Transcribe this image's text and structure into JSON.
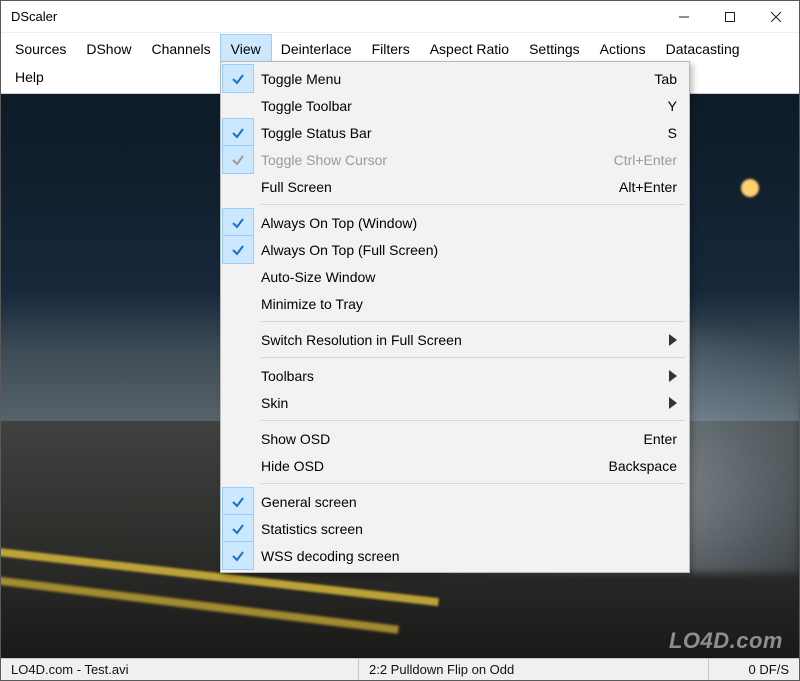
{
  "window": {
    "title": "DScaler"
  },
  "menu": {
    "items": [
      "Sources",
      "DShow",
      "Channels",
      "View",
      "Deinterlace",
      "Filters",
      "Aspect Ratio",
      "Settings",
      "Actions",
      "Datacasting",
      "Help"
    ],
    "active_index": 3
  },
  "view_menu": {
    "items": [
      {
        "label": "Toggle Menu",
        "shortcut": "Tab",
        "checked": true,
        "disabled": false,
        "submenu": false
      },
      {
        "label": "Toggle Toolbar",
        "shortcut": "Y",
        "checked": false,
        "disabled": false,
        "submenu": false
      },
      {
        "label": "Toggle Status Bar",
        "shortcut": "S",
        "checked": true,
        "disabled": false,
        "submenu": false
      },
      {
        "label": "Toggle Show Cursor",
        "shortcut": "Ctrl+Enter",
        "checked": true,
        "disabled": true,
        "submenu": false
      },
      {
        "label": "Full Screen",
        "shortcut": "Alt+Enter",
        "checked": false,
        "disabled": false,
        "submenu": false
      },
      {
        "sep": true
      },
      {
        "label": "Always On Top (Window)",
        "shortcut": "",
        "checked": true,
        "disabled": false,
        "submenu": false
      },
      {
        "label": "Always On Top (Full Screen)",
        "shortcut": "",
        "checked": true,
        "disabled": false,
        "submenu": false
      },
      {
        "label": "Auto-Size Window",
        "shortcut": "",
        "checked": false,
        "disabled": false,
        "submenu": false
      },
      {
        "label": "Minimize to Tray",
        "shortcut": "",
        "checked": false,
        "disabled": false,
        "submenu": false
      },
      {
        "sep": true
      },
      {
        "label": "Switch Resolution in Full Screen",
        "shortcut": "",
        "checked": false,
        "disabled": false,
        "submenu": true
      },
      {
        "sep": true
      },
      {
        "label": "Toolbars",
        "shortcut": "",
        "checked": false,
        "disabled": false,
        "submenu": true
      },
      {
        "label": "Skin",
        "shortcut": "",
        "checked": false,
        "disabled": false,
        "submenu": true
      },
      {
        "sep": true
      },
      {
        "label": "Show OSD",
        "shortcut": "Enter",
        "checked": false,
        "disabled": false,
        "submenu": false
      },
      {
        "label": "Hide OSD",
        "shortcut": "Backspace",
        "checked": false,
        "disabled": false,
        "submenu": false
      },
      {
        "sep": true
      },
      {
        "label": "General screen",
        "shortcut": "",
        "checked": true,
        "disabled": false,
        "submenu": false
      },
      {
        "label": "Statistics screen",
        "shortcut": "",
        "checked": true,
        "disabled": false,
        "submenu": false
      },
      {
        "label": "WSS decoding screen",
        "shortcut": "",
        "checked": true,
        "disabled": false,
        "submenu": false
      }
    ]
  },
  "status": {
    "source": "LO4D.com - Test.avi",
    "mode": "2:2 Pulldown Flip on Odd",
    "fps": "0 DF/S"
  },
  "watermark": "LO4D.com"
}
